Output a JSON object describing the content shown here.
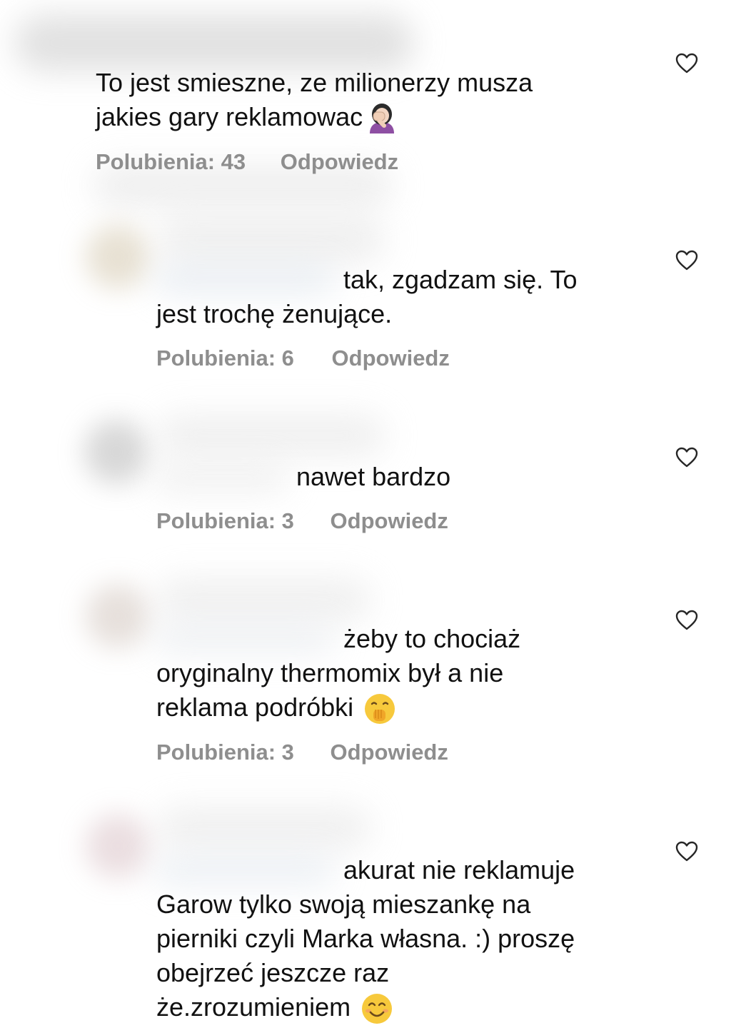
{
  "comments": [
    {
      "lines": [
        "To jest smieszne, ze milionerzy musza",
        "jakies gary reklamowac"
      ],
      "emoji": "face-palm-woman-emoji",
      "likes": "Polubienia: 43",
      "reply": "Odpowiedz"
    },
    {
      "lines": [
        "tak, zgadzam się. To",
        "jest trochę żenujące."
      ],
      "likes": "Polubienia: 6",
      "reply": "Odpowiedz"
    },
    {
      "lines": [
        "nawet bardzo"
      ],
      "likes": "Polubienia: 3",
      "reply": "Odpowiedz"
    },
    {
      "lines": [
        "żeby to chociaż",
        "oryginalny thermomix był a nie",
        "reklama podróbki"
      ],
      "emoji": "hand-over-mouth-emoji",
      "likes": "Polubienia: 3",
      "reply": "Odpowiedz"
    },
    {
      "lines": [
        "akurat nie reklamuje",
        "Garow tylko swoją mieszankę na",
        "pierniki czyli Marka własna. :) proszę",
        "obejrzeć jeszcze raz",
        "że.zrozumieniem"
      ],
      "emoji": "smiling-face-emoji"
    }
  ],
  "icons": {
    "like": "heart-outline-icon"
  },
  "colors": {
    "text": "#111111",
    "meta": "#8e8e8e",
    "icon": "#262626",
    "background": "#ffffff"
  }
}
